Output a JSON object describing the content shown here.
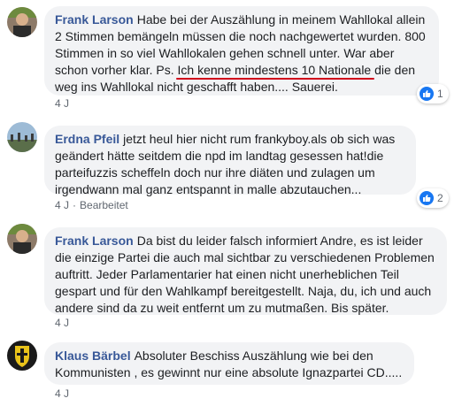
{
  "comments": [
    {
      "author": "Frank Larson",
      "text_before": "Habe bei der Auszählung in meinem Wahllokal allein 2 Stimmen bemängeln müssen die noch nachgewertet wurden. 800 Stimmen in so viel Wahllokalen gehen schnell unter. War aber schon vorher klar. Ps. ",
      "text_underlined": "Ich kenne mindestens 10 Nationale",
      "text_after": " die den weg ins Wahllokal nicht geschafft haben.... Sauerei.",
      "time": "4 J",
      "reactions": "1"
    },
    {
      "author": "Erdna Pfeil",
      "text": "jetzt heul hier nicht rum frankyboy.als ob sich was geändert hätte seitdem die npd im landtag gesessen hat!die parteifuzzis scheffeln doch nur ihre diäten und zulagen um irgendwann mal ganz entspannt in malle abzutauchen...",
      "time": "4 J",
      "edited": "Bearbeitet",
      "reactions": "2"
    },
    {
      "author": "Frank Larson",
      "text": "Da bist du leider falsch informiert Andre, es ist leider die einzige Partei die auch mal sichtbar zu verschiedenen Problemen auftritt. Jeder Parlamentarier hat einen nicht unerheblichen Teil gespart und für den Wahlkampf bereitgestellt. Naja, du, ich und auch andere sind da zu weit entfernt um zu mutmaßen. Bis später.",
      "time": "4 J"
    },
    {
      "author": "Klaus Bärbel",
      "text": "Absoluter Beschiss Auszählung wie bei den Kommunisten , es gewinnt nur eine absolute Ignazpartei CD.....",
      "time": "4 J"
    }
  ],
  "colors": {
    "author": "#385898",
    "bubble": "#f2f3f5",
    "like_blue": "#1877f2",
    "underline": "#d0021b"
  }
}
